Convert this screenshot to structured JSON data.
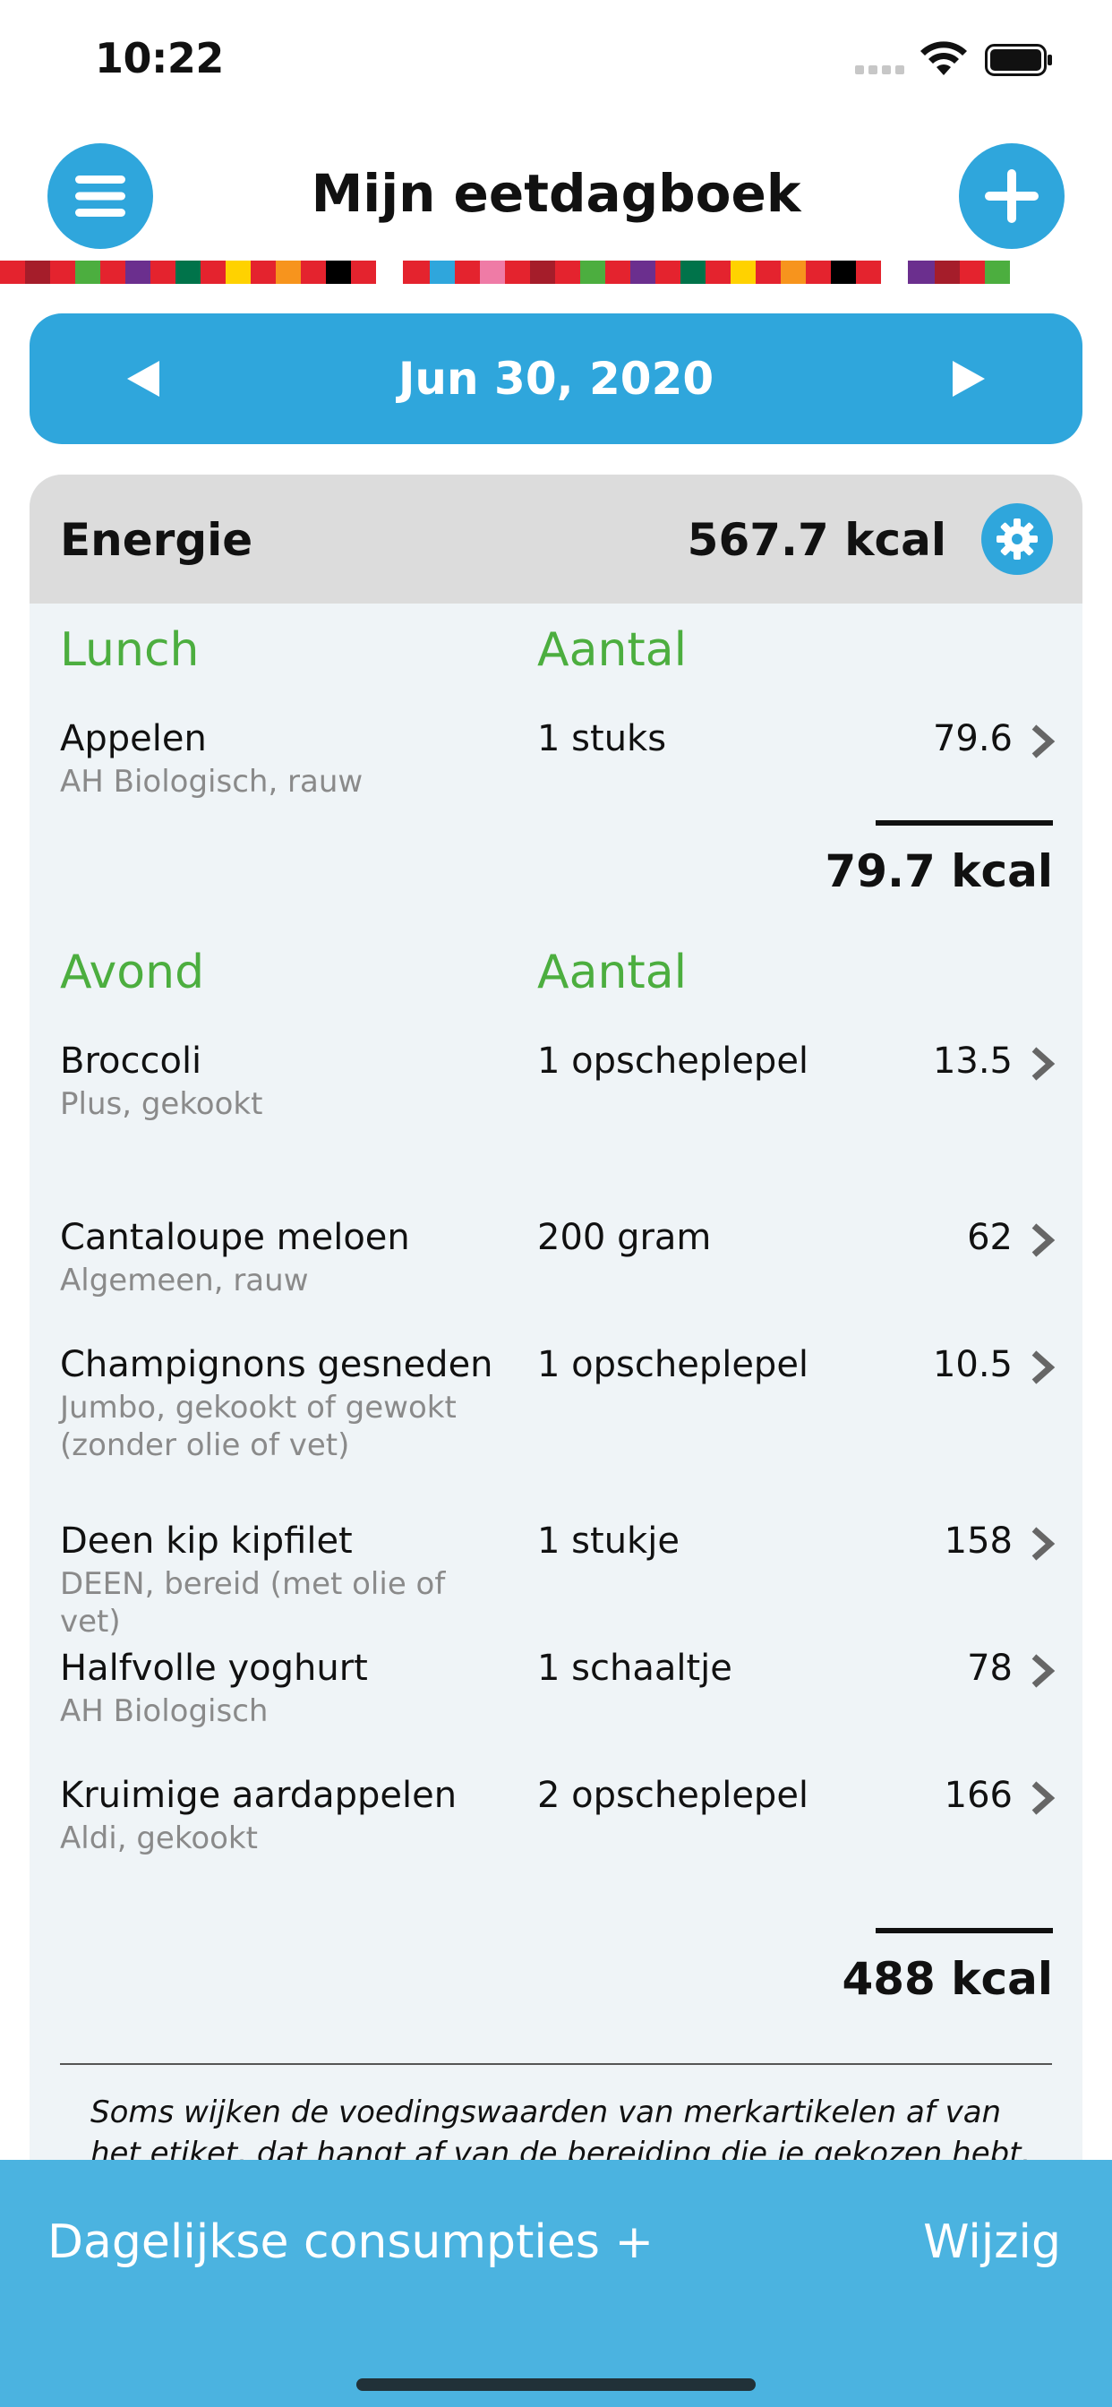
{
  "status": {
    "time": "10:22"
  },
  "header": {
    "title": "Mijn eetdagboek"
  },
  "colors": {
    "accent": "#2fa6dc",
    "section_green": "#4cae3f",
    "card_bg": "#eff4f7",
    "bottom_bar": "#4bb3e0"
  },
  "icons": {
    "menu": "hamburger-menu-icon",
    "add": "plus-icon",
    "prev": "triangle-left-icon",
    "next": "triangle-right-icon",
    "settings": "gear-icon",
    "row": "chevron-right-icon"
  },
  "date": {
    "label": "Jun 30, 2020"
  },
  "energy": {
    "label": "Energie",
    "total": "567.7 kcal"
  },
  "lunch": {
    "title": "Lunch",
    "qty_header": "Aantal",
    "items": [
      {
        "name": "Appelen",
        "sub": "AH Biologisch, rauw",
        "qty": "1 stuks",
        "kcal": "79.6"
      }
    ],
    "total": "79.7 kcal"
  },
  "avond": {
    "title": "Avond",
    "qty_header": "Aantal",
    "items": [
      {
        "name": "Broccoli",
        "sub": "Plus, gekookt",
        "qty": "1 opscheplepel",
        "kcal": "13.5"
      },
      {
        "name": "Cantaloupe meloen",
        "sub": "Algemeen, rauw",
        "qty": "200 gram",
        "kcal": "62"
      },
      {
        "name": "Champignons gesneden",
        "sub": "Jumbo, gekookt of gewokt (zonder olie of vet)",
        "qty": "1 opscheplepel",
        "kcal": "10.5"
      },
      {
        "name": "Deen kip kipfilet",
        "sub": "DEEN, bereid (met olie of vet)",
        "qty": "1 stukje",
        "kcal": "158"
      },
      {
        "name": "Halfvolle yoghurt",
        "sub": "AH Biologisch",
        "qty": "1 schaaltje",
        "kcal": "78"
      },
      {
        "name": "Kruimige aardappelen",
        "sub": "Aldi, gekookt",
        "qty": "2 opscheplepel",
        "kcal": "166"
      }
    ],
    "total": "488 kcal"
  },
  "note": "Soms wijken de voedingswaarden van merkartikelen af van het etiket, dat hangt af van de bereiding die je gekozen hebt. Waarden van",
  "bottom": {
    "left_label": "Dagelijkse consumpties +",
    "right_label": "Wijzig"
  }
}
